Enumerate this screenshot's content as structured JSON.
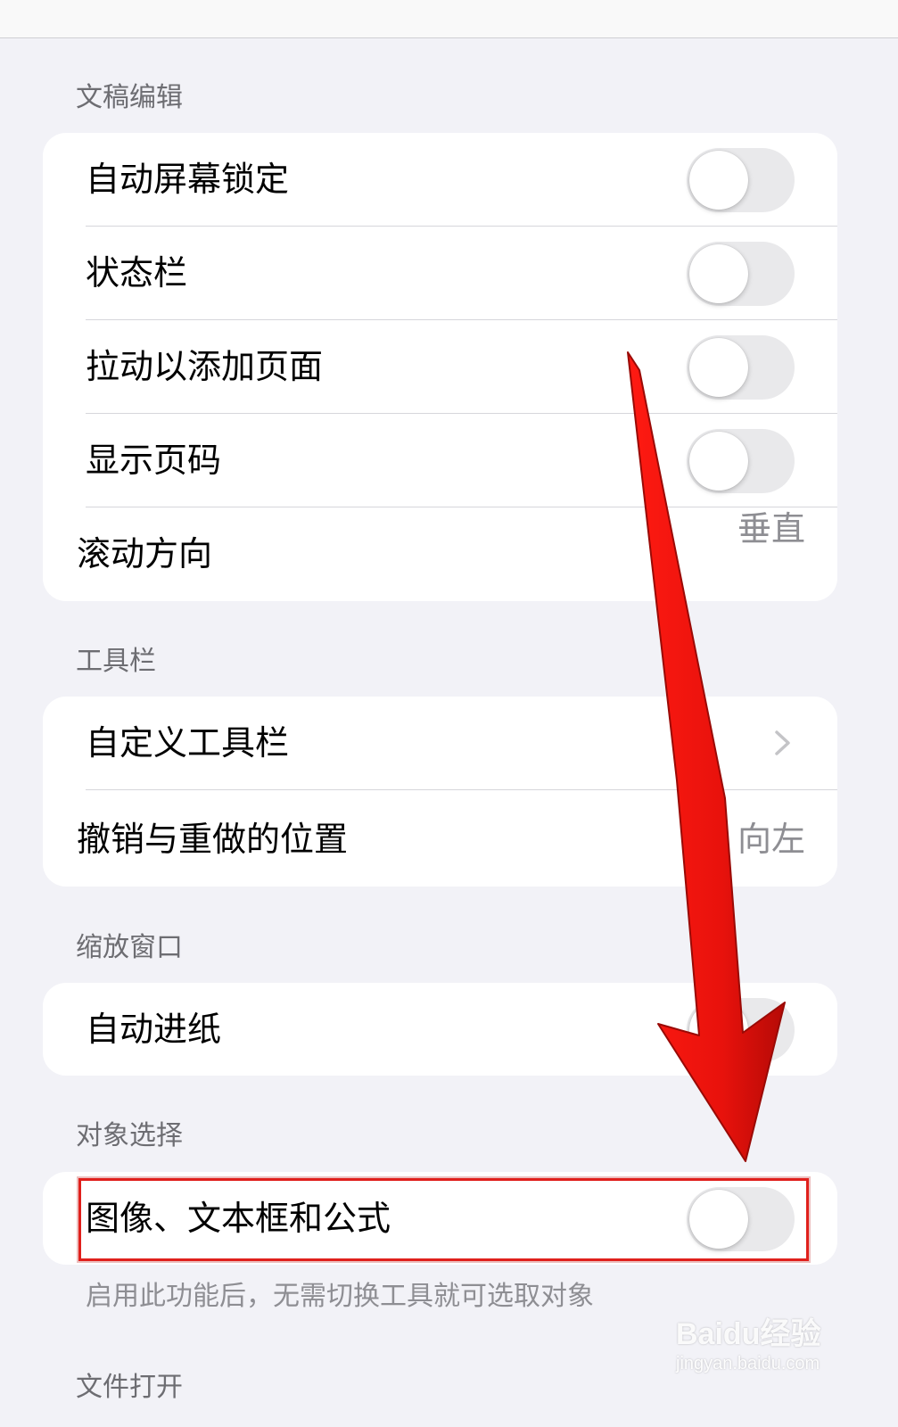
{
  "sections": [
    {
      "header": "文稿编辑",
      "rows": [
        {
          "label": "自动屏幕锁定",
          "type": "toggle",
          "on": false
        },
        {
          "label": "状态栏",
          "type": "toggle",
          "on": false
        },
        {
          "label": "拉动以添加页面",
          "type": "toggle",
          "on": false
        },
        {
          "label": "显示页码",
          "type": "toggle",
          "on": false
        },
        {
          "label": "滚动方向",
          "type": "value",
          "value": "垂直"
        }
      ]
    },
    {
      "header": "工具栏",
      "rows": [
        {
          "label": "自定义工具栏",
          "type": "chevron"
        },
        {
          "label": "撤销与重做的位置",
          "type": "value",
          "value": "向左"
        }
      ]
    },
    {
      "header": "缩放窗口",
      "rows": [
        {
          "label": "自动进纸",
          "type": "toggle",
          "on": false
        }
      ]
    },
    {
      "header": "对象选择",
      "rows": [
        {
          "label": "图像、文本框和公式",
          "type": "toggle",
          "on": false
        }
      ],
      "footnote": "启用此功能后，无需切换工具就可选取对象"
    },
    {
      "header": "文件打开"
    }
  ],
  "icons": {
    "chevron": "chevron-right-icon",
    "annotation_arrow": "red-arrow-icon"
  },
  "watermark": {
    "logo_text": "Baidu经验",
    "url": "jingyan.baidu.com"
  },
  "colors": {
    "background": "#f2f2f7",
    "card": "#ffffff",
    "header_text": "#6d6d72",
    "value_text": "#8e8e93",
    "toggle_off": "#e9e9eb",
    "annotation_red": "#e0201c"
  }
}
